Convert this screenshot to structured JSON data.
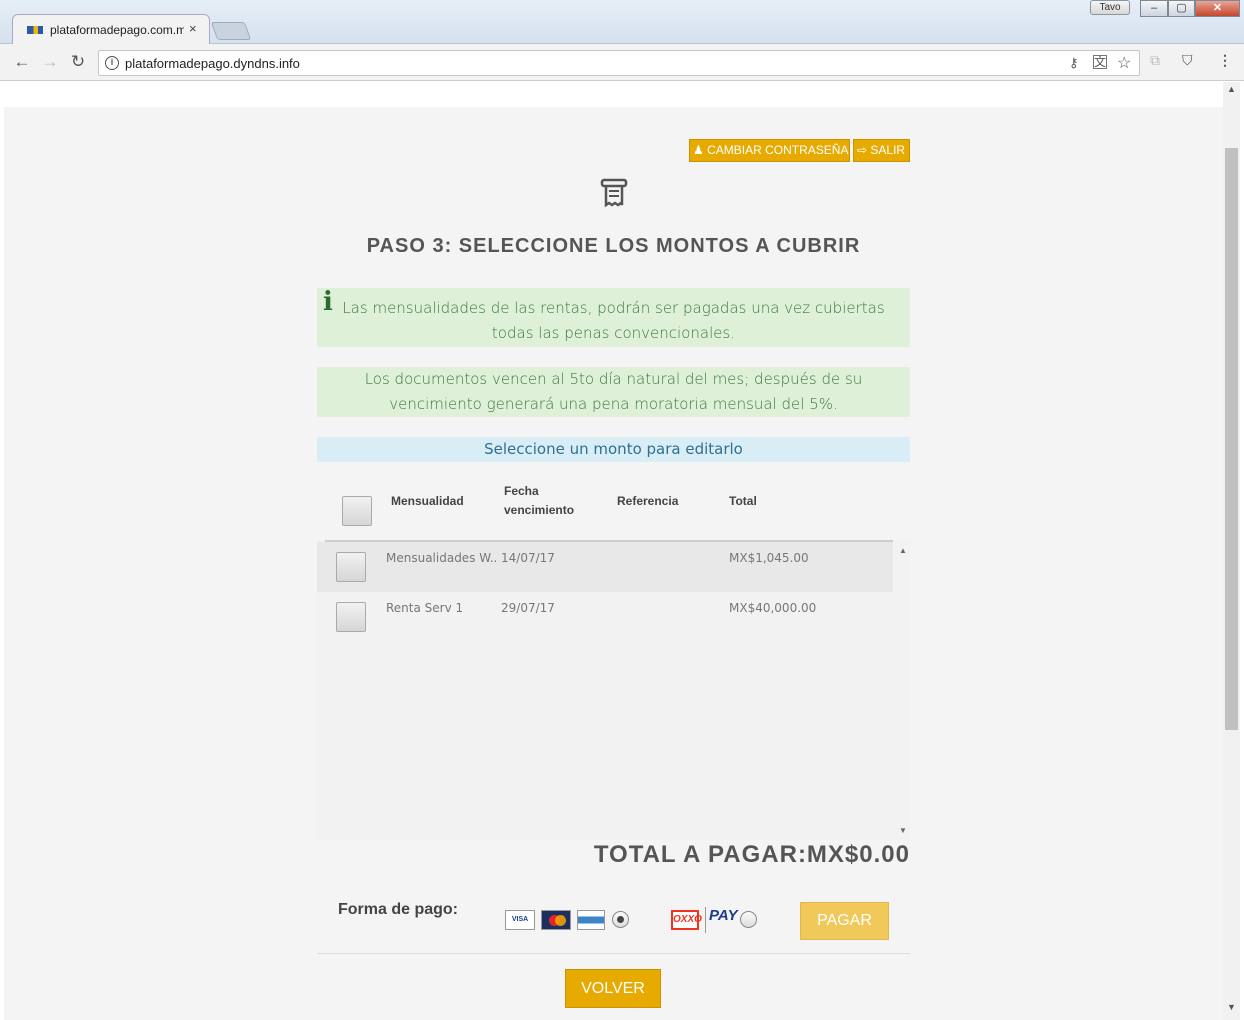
{
  "browser": {
    "tab_title": "plataformadepago.com.m",
    "url": "plataformadepago.dyndns.info",
    "user": "Tavo",
    "close_tab": "×",
    "minimize": "–",
    "maximize": "▢",
    "close_window": "✕"
  },
  "header": {
    "change_password": "CAMBIAR CONTRASEÑA",
    "logout": "SALIR"
  },
  "page": {
    "title": "PASO 3: SELECCIONE LOS MONTOS A CUBRIR",
    "alert_icon": "i",
    "alert1": "Las mensualidades de las rentas, podrán ser pagadas una vez cubiertas todas las penas convencionales.",
    "alert2": "Los documentos vencen al 5to día natural del mes; después de su vencimiento generará una pena moratoria mensual del 5%.",
    "info": "Seleccione un monto para editarlo"
  },
  "table": {
    "headers": [
      "Mensualidad",
      "Fecha vencimiento",
      "Referencia",
      "Total"
    ],
    "rows": [
      {
        "mensualidad": "Mensualidades W...",
        "fecha": "14/07/17",
        "referencia": "",
        "total": "MX$1,045.00"
      },
      {
        "mensualidad": "Renta Serv 1",
        "fecha": "29/07/17",
        "referencia": "",
        "total": "MX$40,000.00"
      }
    ]
  },
  "total": "TOTAL A PAGAR:MX$0.00",
  "payment": {
    "label": "Forma de pago:",
    "cards": [
      "VISA",
      "MasterCard",
      "AMEX"
    ],
    "oxxo": "OXXO",
    "pay": "PAY",
    "pay_button": "PAGAR",
    "back_button": "VOLVER"
  },
  "colors": {
    "accent": "#e6aa00",
    "success_bg": "#dff0d8",
    "info_bg": "#d9edf7"
  }
}
